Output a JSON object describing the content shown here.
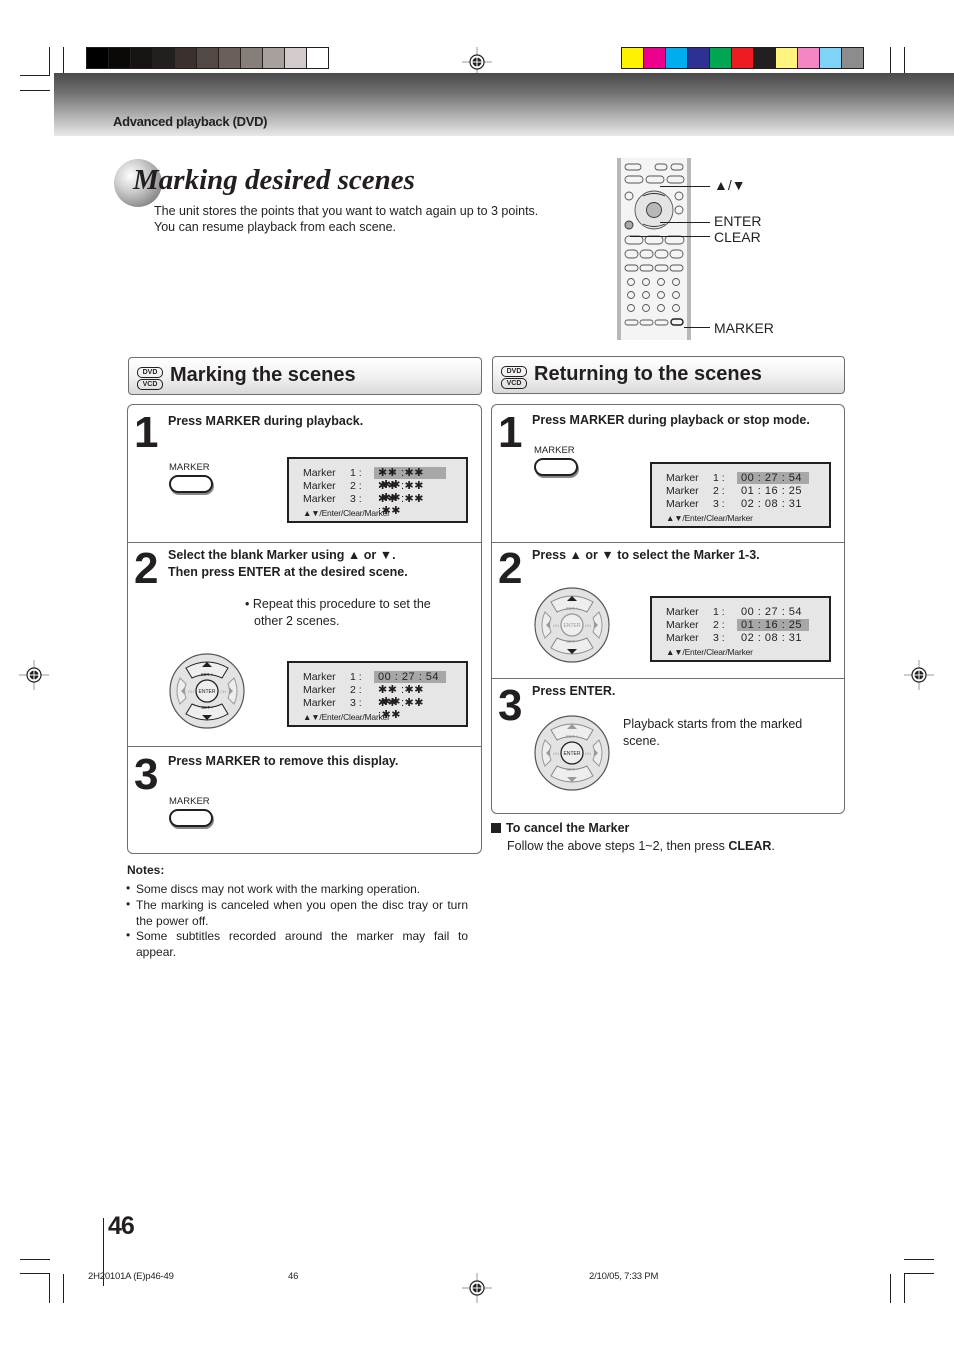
{
  "print_marks": {
    "gray_swatches": [
      "#000000",
      "#0b0908",
      "#171311",
      "#231f1d",
      "#3a312e",
      "#524844",
      "#6a5f5b",
      "#877d79",
      "#a8a09c",
      "#d2cbc9",
      "#ffffff"
    ],
    "color_swatches": [
      "#fff200",
      "#ec008c",
      "#00aeef",
      "#2e3192",
      "#00a651",
      "#ed1c24",
      "#231f20",
      "#fff57e",
      "#f287c3",
      "#7fd3f7",
      "#8c8c8c"
    ]
  },
  "header": {
    "section_label": "Advanced playback (DVD)"
  },
  "title": {
    "text": "Marking desired scenes",
    "intro_line1": "The unit stores the points that you want to watch again up to 3 points.",
    "intro_line2": "You can resume playback from each scene."
  },
  "remote": {
    "labels": {
      "updown": "▲/▼",
      "enter": "ENTER",
      "clear": "CLEAR",
      "marker": "MARKER"
    }
  },
  "disc_badges": [
    "DVD",
    "VCD"
  ],
  "marking": {
    "heading": "Marking the scenes",
    "steps": [
      {
        "num": "1",
        "text": "Press MARKER during playback.",
        "button_label": "MARKER",
        "osd": {
          "rows": [
            {
              "label": "Marker",
              "num": "1 :",
              "value": "✱✱ :✱✱ :✱✱",
              "highlight": true
            },
            {
              "label": "Marker",
              "num": "2 :",
              "value": "✱✱ :✱✱ :✱✱",
              "highlight": false
            },
            {
              "label": "Marker",
              "num": "3 :",
              "value": "✱✱ :✱✱ :✱✱",
              "highlight": false
            }
          ],
          "footer": "▲▼/Enter/Clear/Marker"
        }
      },
      {
        "num": "2",
        "text_line1": "Select the blank Marker using ▲ or ▼.",
        "text_line2": "Then press ENTER at the desired scene.",
        "bullet_line1": "• Repeat this procedure to set the",
        "bullet_line2": "other 2 scenes.",
        "osd": {
          "rows": [
            {
              "label": "Marker",
              "num": "1 :",
              "value": "00 : 27 : 54",
              "highlight": true
            },
            {
              "label": "Marker",
              "num": "2 :",
              "value": "✱✱ :✱✱ :✱✱",
              "highlight": false
            },
            {
              "label": "Marker",
              "num": "3 :",
              "value": "✱✱ :✱✱ :✱✱",
              "highlight": false
            }
          ],
          "footer": "▲▼/Enter/Clear/Marker"
        }
      },
      {
        "num": "3",
        "text": "Press MARKER to remove this display.",
        "button_label": "MARKER"
      }
    ]
  },
  "dpad_labels": {
    "set_plus": "SET +",
    "set_minus": "SET -",
    "enter": "ENTER",
    "ch": "CH"
  },
  "returning": {
    "heading": "Returning to the scenes",
    "steps": [
      {
        "num": "1",
        "text": "Press MARKER during playback or stop mode.",
        "button_label": "MARKER",
        "osd": {
          "rows": [
            {
              "label": "Marker",
              "num": "1 :",
              "value": "00 : 27 : 54",
              "highlight": true
            },
            {
              "label": "Marker",
              "num": "2 :",
              "value": "01 : 16 : 25",
              "highlight": false
            },
            {
              "label": "Marker",
              "num": "3 :",
              "value": "02 : 08 : 31",
              "highlight": false
            }
          ],
          "footer": "▲▼/Enter/Clear/Marker"
        }
      },
      {
        "num": "2",
        "text": "Press ▲ or ▼ to select the Marker 1-3.",
        "osd": {
          "rows": [
            {
              "label": "Marker",
              "num": "1 :",
              "value": "00 : 27 : 54",
              "highlight": false
            },
            {
              "label": "Marker",
              "num": "2 :",
              "value": "01 : 16 : 25",
              "highlight": true
            },
            {
              "label": "Marker",
              "num": "3 :",
              "value": "02 : 08 : 31",
              "highlight": false
            }
          ],
          "footer": "▲▼/Enter/Clear/Marker"
        }
      },
      {
        "num": "3",
        "text": "Press ENTER.",
        "body_line1": "Playback starts from the marked",
        "body_line2": "scene."
      }
    ]
  },
  "cancel": {
    "title": "To cancel the Marker",
    "body_prefix": "Follow the above steps 1~2, then press ",
    "body_bold": "CLEAR",
    "body_suffix": "."
  },
  "notes": {
    "title": "Notes:",
    "items": [
      "Some discs may not work with the marking operation.",
      "The marking is canceled when you open the disc tray or turn the power off.",
      "Some subtitles recorded around the marker may fail to appear."
    ]
  },
  "page_number": "46",
  "footer": {
    "file": "2H20101A (E)p46-49",
    "page": "46",
    "timestamp": "2/10/05, 7:33 PM"
  }
}
